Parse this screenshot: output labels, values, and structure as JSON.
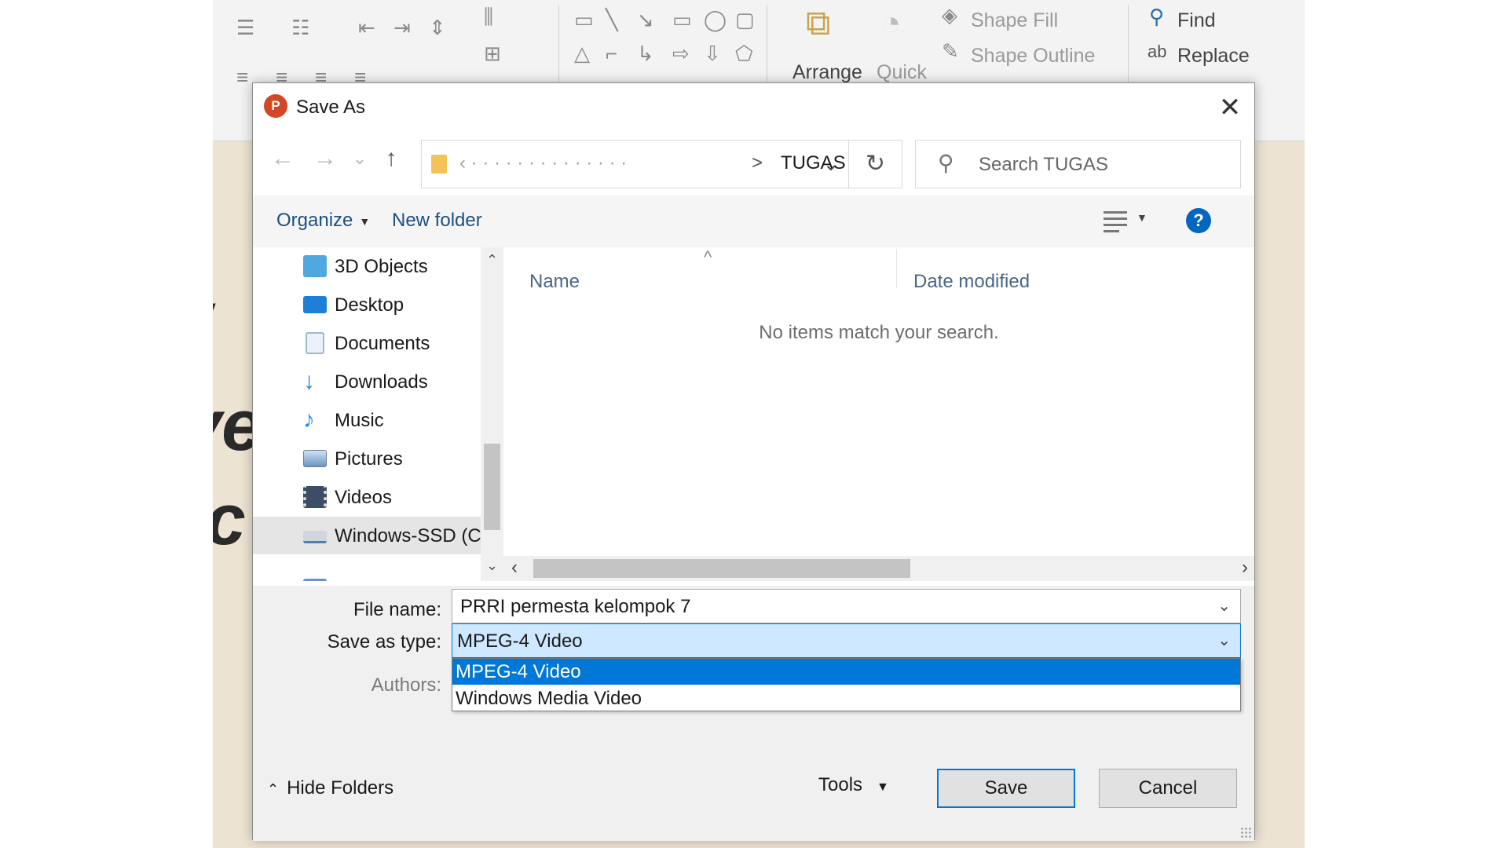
{
  "ribbon": {
    "arrange_label": "Arrange",
    "quick_label": "Quick",
    "shape_fill_label": "Shape Fill",
    "shape_outline_label": "Shape Outline",
    "find_label": "Find",
    "replace_label": "Replace"
  },
  "dialog": {
    "title": "Save As",
    "close_glyph": "✕"
  },
  "nav": {
    "back_glyph": "←",
    "forward_glyph": "→",
    "recent_glyph": "⌄",
    "up_glyph": "↑",
    "refresh_glyph": "↻",
    "address_separator": ">",
    "address_current": "TUGAS",
    "address_dropdown_glyph": "⌄",
    "search_placeholder": "Search TUGAS"
  },
  "toolbar": {
    "organize_label": "Organize",
    "new_folder_label": "New folder",
    "help_glyph": "?"
  },
  "sidebar": {
    "items": [
      {
        "label": "3D Objects",
        "icon": "cube-icon",
        "color": "#4fa8e0"
      },
      {
        "label": "Desktop",
        "icon": "desktop-icon",
        "color": "#1e7fd8"
      },
      {
        "label": "Documents",
        "icon": "documents-icon",
        "color": "#9fb7d4"
      },
      {
        "label": "Downloads",
        "icon": "downloads-icon",
        "color": "#2b7fd6"
      },
      {
        "label": "Music",
        "icon": "music-icon",
        "color": "#2b8fe0"
      },
      {
        "label": "Pictures",
        "icon": "pictures-icon",
        "color": "#6a95c0"
      },
      {
        "label": "Videos",
        "icon": "videos-icon",
        "color": "#3d4d66"
      },
      {
        "label": "Windows-SSD (C",
        "icon": "drive-icon",
        "color": "#4a7fb8"
      }
    ]
  },
  "filelist": {
    "column_name": "Name",
    "column_date": "Date modified",
    "empty_message": "No items match your search."
  },
  "form": {
    "file_name_label": "File name:",
    "file_name_value": "PRRI permesta kelompok 7",
    "save_as_type_label": "Save as type:",
    "save_as_type_value": "MPEG-4 Video",
    "type_options": [
      "MPEG-4 Video",
      "Windows Media Video"
    ],
    "authors_label": "Authors:"
  },
  "footer": {
    "hide_folders_label": "Hide Folders",
    "tools_label": "Tools",
    "save_label": "Save",
    "cancel_label": "Cancel"
  },
  "colors": {
    "accent": "#0078d7",
    "selection_bg": "#cde8ff",
    "link_text": "#1d4f80",
    "powerpoint": "#d24726"
  }
}
